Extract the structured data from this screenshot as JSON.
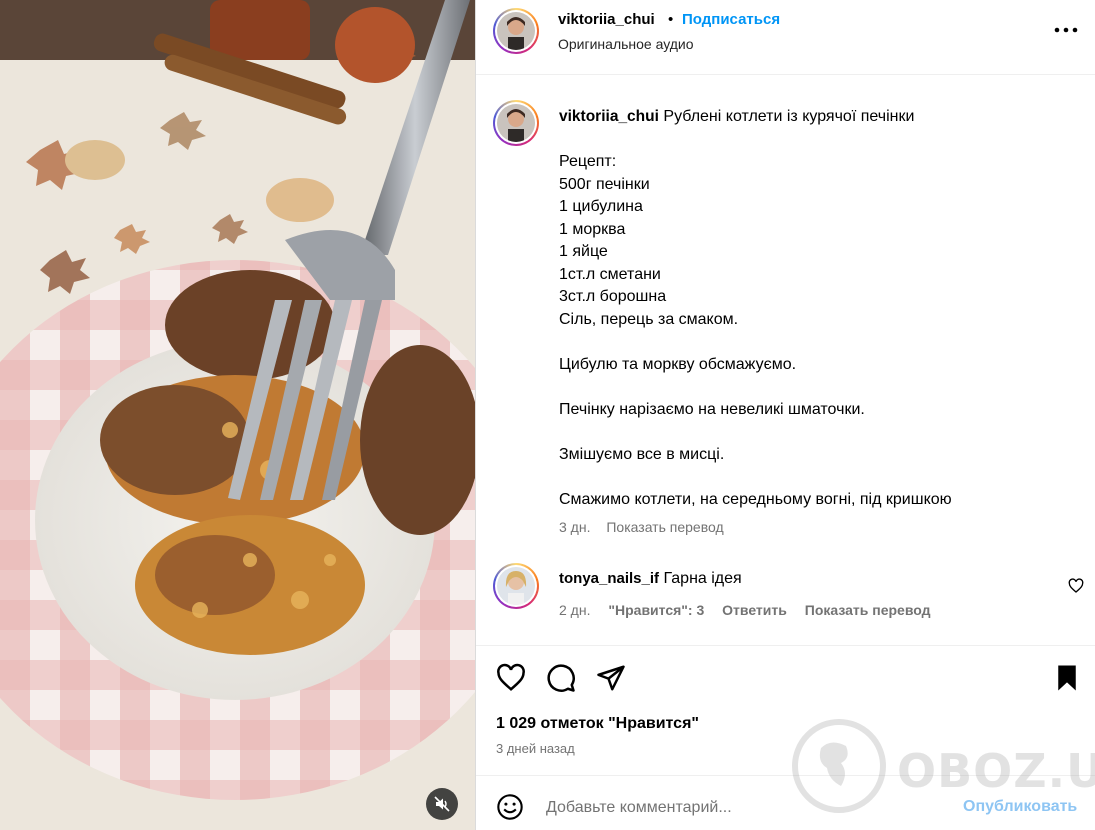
{
  "media": {
    "mute_icon": "speaker-muted-icon"
  },
  "header": {
    "username": "viktoriia_chui",
    "separator": "•",
    "follow_label": "Подписаться",
    "audio_label": "Оригинальное аудио",
    "more_icon": "more-horizontal-icon"
  },
  "caption": {
    "username": "viktoriia_chui",
    "text": "Рублені котлети із курячої печінки\n\nРецепт:\n500г печінки\n1 цибулина\n1 морква\n1 яйце\n1ст.л сметани\n3ст.л борошна\nСіль, перець за смаком.\n\nЦибулю та моркву обсмажуємо.\n\nПечінку нарізаємо на невеликі шматочки.\n\nЗмішуємо все в мисці.\n\nСмажимо котлети, на середньому вогні, під кришкою",
    "time": "3 дн.",
    "translate_label": "Показать перевод"
  },
  "comment": {
    "username": "tonya_nails_if",
    "text": "Гарна ідея",
    "time": "2 дн.",
    "likes_label": "\"Нравится\": 3",
    "reply_label": "Ответить",
    "translate_label": "Показать перевод"
  },
  "actions": {
    "likes_text": "1 029 отметок \"Нравится\"",
    "date_text": "3 дней назад"
  },
  "add_comment": {
    "placeholder": "Добавьте комментарий...",
    "publish_label": "Опубликовать"
  },
  "watermark": {
    "text": "OBOZ.UA"
  },
  "colors": {
    "accent": "#0095f6",
    "publish_disabled": "#8ec5f3",
    "meta_text": "#737373"
  }
}
